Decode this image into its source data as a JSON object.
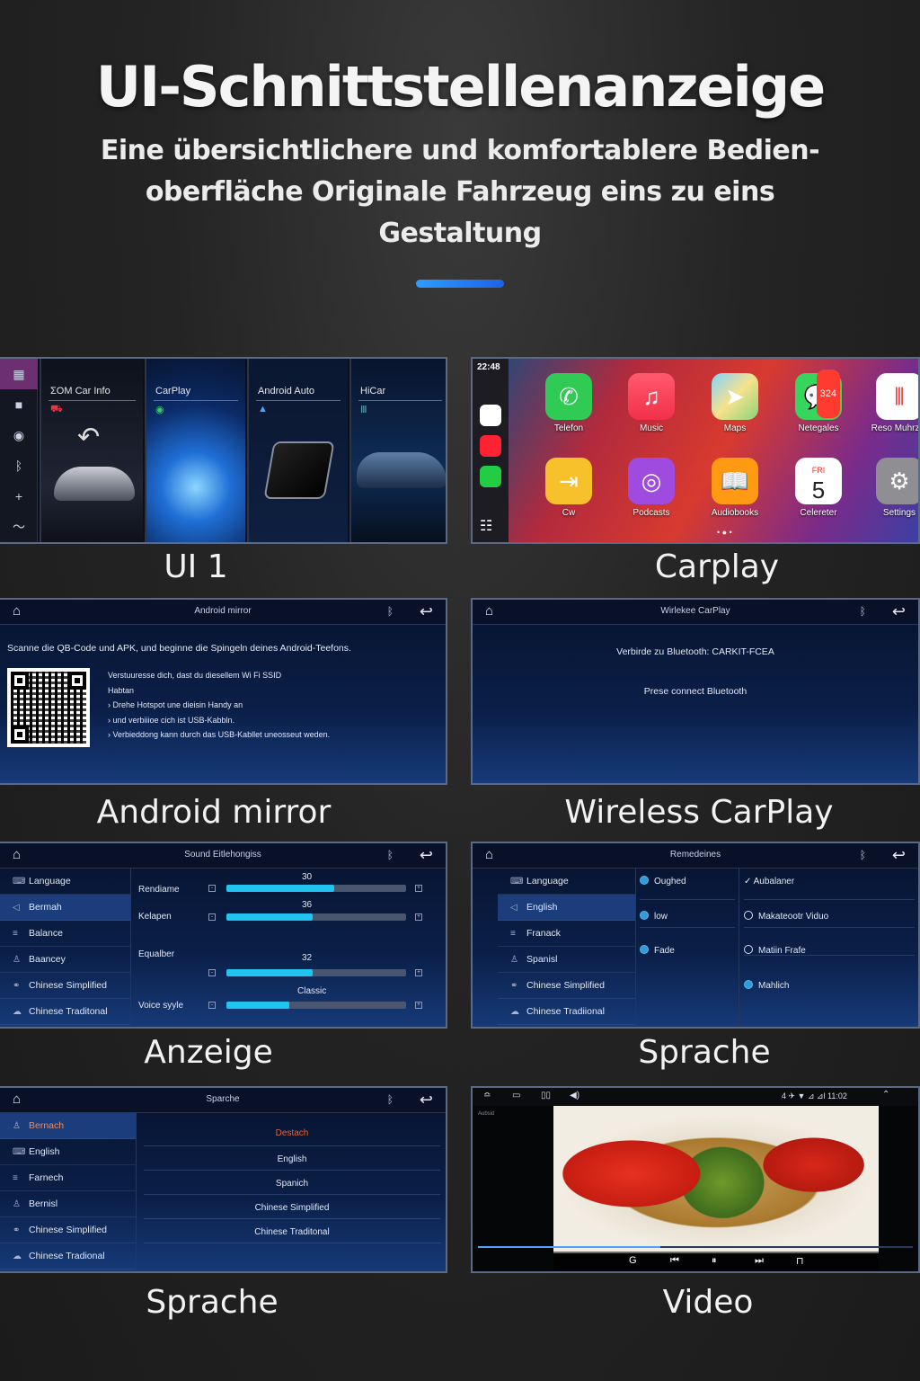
{
  "hero": {
    "title": "UI-Schnittstellenanzeige",
    "subtitle_line1": "Eine übersichtlichere und komfortablere Bedien-",
    "subtitle_line2": "oberfläche Originale Fahrzeug eins zu eins",
    "subtitle_line3": "Gestaltung"
  },
  "captions": {
    "ui1": "UI 1",
    "carplay": "Carplay",
    "android_mirror": "Android mirror",
    "wireless_carplay": "Wireless CarPlay",
    "anzeige": "Anzeige",
    "sprache1": "Sprache",
    "sprache2": "Sprache",
    "video": "Video"
  },
  "ui1": {
    "cards": [
      "ΣOM Car Info",
      "CarPlay",
      "Android Auto",
      "HiCar"
    ]
  },
  "carplay": {
    "time": "22:48",
    "badge": "324",
    "apps": [
      "Telefon",
      "Music",
      "Maps",
      "Netegales",
      "Reso Muhrzer",
      "Cw",
      "Podcasts",
      "Audiobooks",
      "Celereter",
      "Settings"
    ],
    "calendar_day": "FRI",
    "calendar_num": "5"
  },
  "android_mirror": {
    "title": "Android mirror",
    "instruction": "Scanne die QB-Code und APK, und beginne die Spingeln deines Android-Teefons.",
    "lines": [
      "Verstuuresse dich, dast du diesellem Wi Fi SSID",
      "Habtan",
      "› Drehe Hotspot une dieisin Handy an",
      "› und verbiiioe cich ist USB-Kabbln.",
      "› Verbieddong kann durch das USB-Kabllet uneosseut weden."
    ]
  },
  "wireless_carplay": {
    "title": "Wirlekee CarPlay",
    "line1": "Verbirde zu Bluetooth: CARKIT-FCEA",
    "line2": "Prese connect Bluetooth"
  },
  "anzeige": {
    "title": "Sound Eitlehongiss",
    "menu": [
      "Language",
      "Bermah",
      "Balance",
      "Baancey",
      "Chinese Simplified",
      "Chinese Traditonal"
    ],
    "labels": [
      "Rendiame",
      "Kelapen",
      "Equalber",
      "Voice syyle"
    ],
    "values": [
      "30",
      "36",
      "32",
      "Classic"
    ],
    "levels": [
      0.6,
      0.48,
      0.48,
      0.35
    ]
  },
  "sprache1": {
    "title": "Remedeines",
    "menu": [
      "Language",
      "English",
      "Franack",
      "Spanisl",
      "Chinese Simplified",
      "Chinese Tradiional"
    ],
    "col2": [
      "Oughed",
      "low",
      "Fade"
    ],
    "col3": [
      "✓ Aubalaner",
      "Makateootr Viduo",
      "Matiin Frafe",
      "Mahlich"
    ]
  },
  "sprache2": {
    "title": "Sparche",
    "menu": [
      "Bernach",
      "English",
      "Farnech",
      "Bernisl",
      "Chinese Simplified",
      "Chinese Tradional"
    ],
    "options": [
      "Destach",
      "English",
      "Spanich",
      "Chinese Simplified",
      "Chinese Traditonal"
    ],
    "accent": "#e4643a"
  },
  "video": {
    "status": "4  ✈  ▼ ⊿ ⊿l  11:02",
    "tiny1": "Aubsid"
  }
}
